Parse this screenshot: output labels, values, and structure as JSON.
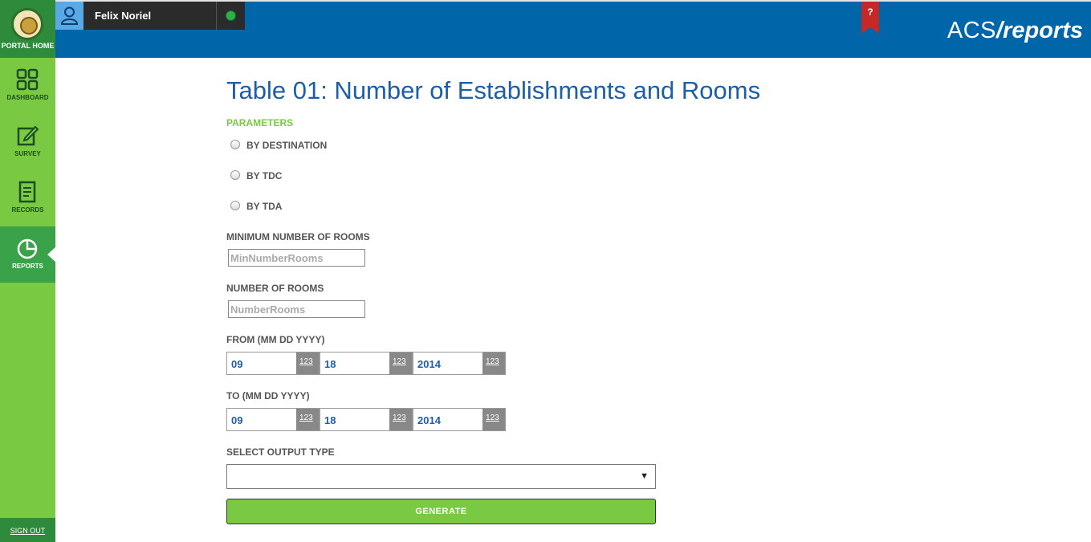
{
  "sidebar": {
    "portal_label": "PORTAL HOME",
    "items": [
      {
        "label": "DASHBOARD",
        "icon": "grid-icon"
      },
      {
        "label": "SURVEY",
        "icon": "edit-icon"
      },
      {
        "label": "RECORDS",
        "icon": "document-icon"
      },
      {
        "label": "REPORTS",
        "icon": "pie-chart-icon"
      }
    ],
    "active": "REPORTS",
    "signout_label": "SIGN OUT"
  },
  "header": {
    "user_name": "Felix Noriel",
    "status_color": "#2ab24a",
    "help_label": "?",
    "brand_prefix": "ACS",
    "brand_suffix": "/reports",
    "bar_color": "#0066aa"
  },
  "main": {
    "title": "Table 01: Number of Establishments and Rooms",
    "parameters_label": "PARAMETERS",
    "radios": [
      {
        "label": "BY DESTINATION",
        "checked": false
      },
      {
        "label": "BY TDC",
        "checked": false
      },
      {
        "label": "BY TDA",
        "checked": false
      }
    ],
    "min_rooms": {
      "label": "MINIMUM NUMBER OF ROOMS",
      "placeholder": "MinNumberRooms",
      "value": ""
    },
    "rooms": {
      "label": "NUMBER OF ROOMS",
      "placeholder": "NumberRooms",
      "value": ""
    },
    "from": {
      "label": "FROM (MM DD YYYY)",
      "month": "09",
      "day": "18",
      "year": "2014",
      "numeric_badge": "123"
    },
    "to": {
      "label": "TO (MM DD YYYY)",
      "month": "09",
      "day": "18",
      "year": "2014",
      "numeric_badge": "123"
    },
    "output_type": {
      "label": "SELECT OUTPUT TYPE",
      "selected": ""
    },
    "generate_label": "GENERATE"
  },
  "colors": {
    "accent_green": "#7ac943",
    "title_blue": "#1d5fa6"
  }
}
